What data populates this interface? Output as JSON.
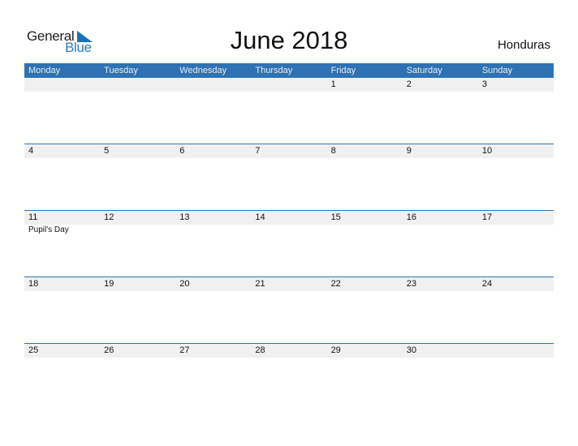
{
  "logo": {
    "line1": "General",
    "line2": "Blue"
  },
  "title": "June 2018",
  "country": "Honduras",
  "colors": {
    "header": "#2e72b3",
    "strip": "#f0f0f0",
    "logo_blue": "#2a7bc4"
  },
  "weekdays": [
    "Monday",
    "Tuesday",
    "Wednesday",
    "Thursday",
    "Friday",
    "Saturday",
    "Sunday"
  ],
  "weeks": [
    {
      "days": [
        "",
        "",
        "",
        "",
        "1",
        "2",
        "3"
      ],
      "events": [
        "",
        "",
        "",
        "",
        "",
        "",
        ""
      ]
    },
    {
      "days": [
        "4",
        "5",
        "6",
        "7",
        "8",
        "9",
        "10"
      ],
      "events": [
        "",
        "",
        "",
        "",
        "",
        "",
        ""
      ]
    },
    {
      "days": [
        "11",
        "12",
        "13",
        "14",
        "15",
        "16",
        "17"
      ],
      "events": [
        "Pupil's Day",
        "",
        "",
        "",
        "",
        "",
        ""
      ]
    },
    {
      "days": [
        "18",
        "19",
        "20",
        "21",
        "22",
        "23",
        "24"
      ],
      "events": [
        "",
        "",
        "",
        "",
        "",
        "",
        ""
      ]
    },
    {
      "days": [
        "25",
        "26",
        "27",
        "28",
        "29",
        "30",
        ""
      ],
      "events": [
        "",
        "",
        "",
        "",
        "",
        "",
        ""
      ]
    }
  ]
}
